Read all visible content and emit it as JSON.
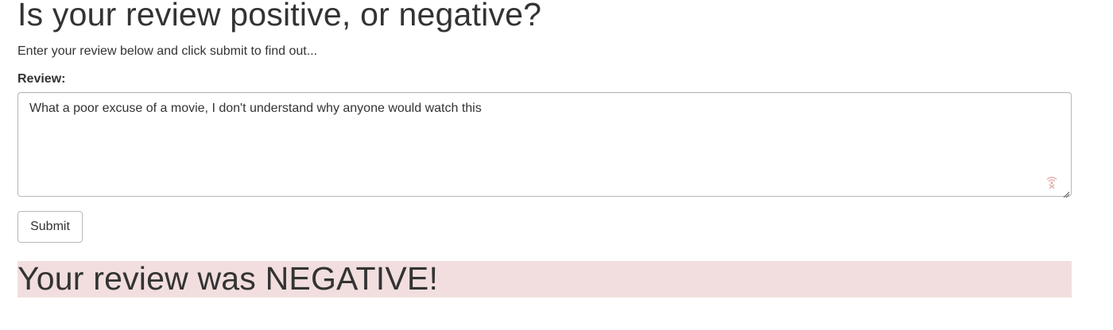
{
  "page": {
    "title": "Is your review positive, or negative?",
    "subtitle": "Enter your review below and click submit to find out..."
  },
  "form": {
    "review_label": "Review:",
    "review_value": "What a poor excuse of a movie, I don't understand why anyone would watch this",
    "submit_label": "Submit",
    "textarea_icon": "dictation-off-icon"
  },
  "result": {
    "text": "Your review was NEGATIVE!",
    "background_color": "#f2dede"
  },
  "colors": {
    "text": "#333333",
    "border": "#b8b8b8"
  }
}
